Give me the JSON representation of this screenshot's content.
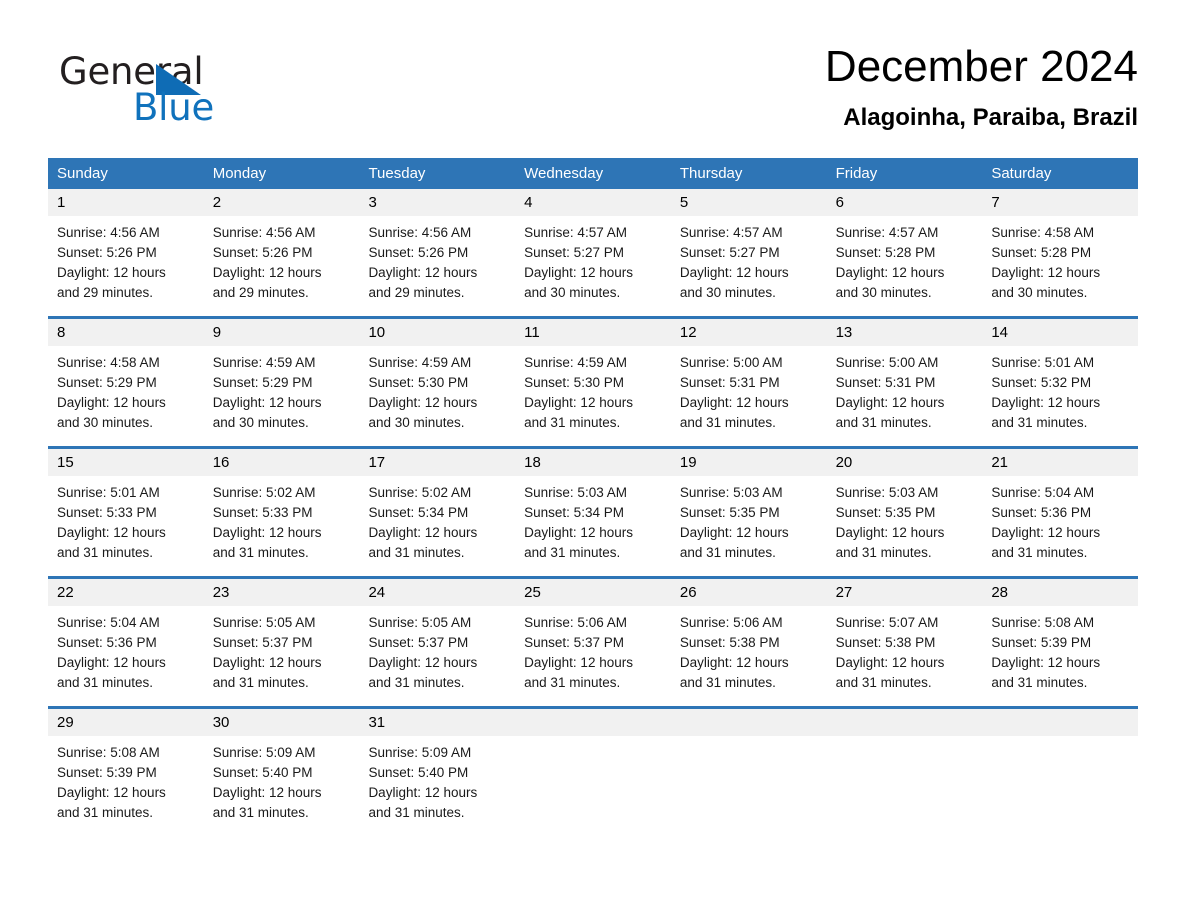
{
  "brand": {
    "name_part1": "General",
    "name_part2": "Blue"
  },
  "header": {
    "month_title": "December 2024",
    "location": "Alagoinha, Paraiba, Brazil"
  },
  "calendar": {
    "day_headers": [
      "Sunday",
      "Monday",
      "Tuesday",
      "Wednesday",
      "Thursday",
      "Friday",
      "Saturday"
    ],
    "accent_color": "#2e75b6",
    "numberband_color": "#f1f1f1",
    "weeks": [
      {
        "days": [
          {
            "num": "1",
            "sunrise": "Sunrise: 4:56 AM",
            "sunset": "Sunset: 5:26 PM",
            "daylight1": "Daylight: 12 hours",
            "daylight2": "and 29 minutes."
          },
          {
            "num": "2",
            "sunrise": "Sunrise: 4:56 AM",
            "sunset": "Sunset: 5:26 PM",
            "daylight1": "Daylight: 12 hours",
            "daylight2": "and 29 minutes."
          },
          {
            "num": "3",
            "sunrise": "Sunrise: 4:56 AM",
            "sunset": "Sunset: 5:26 PM",
            "daylight1": "Daylight: 12 hours",
            "daylight2": "and 29 minutes."
          },
          {
            "num": "4",
            "sunrise": "Sunrise: 4:57 AM",
            "sunset": "Sunset: 5:27 PM",
            "daylight1": "Daylight: 12 hours",
            "daylight2": "and 30 minutes."
          },
          {
            "num": "5",
            "sunrise": "Sunrise: 4:57 AM",
            "sunset": "Sunset: 5:27 PM",
            "daylight1": "Daylight: 12 hours",
            "daylight2": "and 30 minutes."
          },
          {
            "num": "6",
            "sunrise": "Sunrise: 4:57 AM",
            "sunset": "Sunset: 5:28 PM",
            "daylight1": "Daylight: 12 hours",
            "daylight2": "and 30 minutes."
          },
          {
            "num": "7",
            "sunrise": "Sunrise: 4:58 AM",
            "sunset": "Sunset: 5:28 PM",
            "daylight1": "Daylight: 12 hours",
            "daylight2": "and 30 minutes."
          }
        ]
      },
      {
        "days": [
          {
            "num": "8",
            "sunrise": "Sunrise: 4:58 AM",
            "sunset": "Sunset: 5:29 PM",
            "daylight1": "Daylight: 12 hours",
            "daylight2": "and 30 minutes."
          },
          {
            "num": "9",
            "sunrise": "Sunrise: 4:59 AM",
            "sunset": "Sunset: 5:29 PM",
            "daylight1": "Daylight: 12 hours",
            "daylight2": "and 30 minutes."
          },
          {
            "num": "10",
            "sunrise": "Sunrise: 4:59 AM",
            "sunset": "Sunset: 5:30 PM",
            "daylight1": "Daylight: 12 hours",
            "daylight2": "and 30 minutes."
          },
          {
            "num": "11",
            "sunrise": "Sunrise: 4:59 AM",
            "sunset": "Sunset: 5:30 PM",
            "daylight1": "Daylight: 12 hours",
            "daylight2": "and 31 minutes."
          },
          {
            "num": "12",
            "sunrise": "Sunrise: 5:00 AM",
            "sunset": "Sunset: 5:31 PM",
            "daylight1": "Daylight: 12 hours",
            "daylight2": "and 31 minutes."
          },
          {
            "num": "13",
            "sunrise": "Sunrise: 5:00 AM",
            "sunset": "Sunset: 5:31 PM",
            "daylight1": "Daylight: 12 hours",
            "daylight2": "and 31 minutes."
          },
          {
            "num": "14",
            "sunrise": "Sunrise: 5:01 AM",
            "sunset": "Sunset: 5:32 PM",
            "daylight1": "Daylight: 12 hours",
            "daylight2": "and 31 minutes."
          }
        ]
      },
      {
        "days": [
          {
            "num": "15",
            "sunrise": "Sunrise: 5:01 AM",
            "sunset": "Sunset: 5:33 PM",
            "daylight1": "Daylight: 12 hours",
            "daylight2": "and 31 minutes."
          },
          {
            "num": "16",
            "sunrise": "Sunrise: 5:02 AM",
            "sunset": "Sunset: 5:33 PM",
            "daylight1": "Daylight: 12 hours",
            "daylight2": "and 31 minutes."
          },
          {
            "num": "17",
            "sunrise": "Sunrise: 5:02 AM",
            "sunset": "Sunset: 5:34 PM",
            "daylight1": "Daylight: 12 hours",
            "daylight2": "and 31 minutes."
          },
          {
            "num": "18",
            "sunrise": "Sunrise: 5:03 AM",
            "sunset": "Sunset: 5:34 PM",
            "daylight1": "Daylight: 12 hours",
            "daylight2": "and 31 minutes."
          },
          {
            "num": "19",
            "sunrise": "Sunrise: 5:03 AM",
            "sunset": "Sunset: 5:35 PM",
            "daylight1": "Daylight: 12 hours",
            "daylight2": "and 31 minutes."
          },
          {
            "num": "20",
            "sunrise": "Sunrise: 5:03 AM",
            "sunset": "Sunset: 5:35 PM",
            "daylight1": "Daylight: 12 hours",
            "daylight2": "and 31 minutes."
          },
          {
            "num": "21",
            "sunrise": "Sunrise: 5:04 AM",
            "sunset": "Sunset: 5:36 PM",
            "daylight1": "Daylight: 12 hours",
            "daylight2": "and 31 minutes."
          }
        ]
      },
      {
        "days": [
          {
            "num": "22",
            "sunrise": "Sunrise: 5:04 AM",
            "sunset": "Sunset: 5:36 PM",
            "daylight1": "Daylight: 12 hours",
            "daylight2": "and 31 minutes."
          },
          {
            "num": "23",
            "sunrise": "Sunrise: 5:05 AM",
            "sunset": "Sunset: 5:37 PM",
            "daylight1": "Daylight: 12 hours",
            "daylight2": "and 31 minutes."
          },
          {
            "num": "24",
            "sunrise": "Sunrise: 5:05 AM",
            "sunset": "Sunset: 5:37 PM",
            "daylight1": "Daylight: 12 hours",
            "daylight2": "and 31 minutes."
          },
          {
            "num": "25",
            "sunrise": "Sunrise: 5:06 AM",
            "sunset": "Sunset: 5:37 PM",
            "daylight1": "Daylight: 12 hours",
            "daylight2": "and 31 minutes."
          },
          {
            "num": "26",
            "sunrise": "Sunrise: 5:06 AM",
            "sunset": "Sunset: 5:38 PM",
            "daylight1": "Daylight: 12 hours",
            "daylight2": "and 31 minutes."
          },
          {
            "num": "27",
            "sunrise": "Sunrise: 5:07 AM",
            "sunset": "Sunset: 5:38 PM",
            "daylight1": "Daylight: 12 hours",
            "daylight2": "and 31 minutes."
          },
          {
            "num": "28",
            "sunrise": "Sunrise: 5:08 AM",
            "sunset": "Sunset: 5:39 PM",
            "daylight1": "Daylight: 12 hours",
            "daylight2": "and 31 minutes."
          }
        ]
      },
      {
        "days": [
          {
            "num": "29",
            "sunrise": "Sunrise: 5:08 AM",
            "sunset": "Sunset: 5:39 PM",
            "daylight1": "Daylight: 12 hours",
            "daylight2": "and 31 minutes."
          },
          {
            "num": "30",
            "sunrise": "Sunrise: 5:09 AM",
            "sunset": "Sunset: 5:40 PM",
            "daylight1": "Daylight: 12 hours",
            "daylight2": "and 31 minutes."
          },
          {
            "num": "31",
            "sunrise": "Sunrise: 5:09 AM",
            "sunset": "Sunset: 5:40 PM",
            "daylight1": "Daylight: 12 hours",
            "daylight2": "and 31 minutes."
          },
          {
            "num": "",
            "sunrise": "",
            "sunset": "",
            "daylight1": "",
            "daylight2": ""
          },
          {
            "num": "",
            "sunrise": "",
            "sunset": "",
            "daylight1": "",
            "daylight2": ""
          },
          {
            "num": "",
            "sunrise": "",
            "sunset": "",
            "daylight1": "",
            "daylight2": ""
          },
          {
            "num": "",
            "sunrise": "",
            "sunset": "",
            "daylight1": "",
            "daylight2": ""
          }
        ]
      }
    ]
  }
}
